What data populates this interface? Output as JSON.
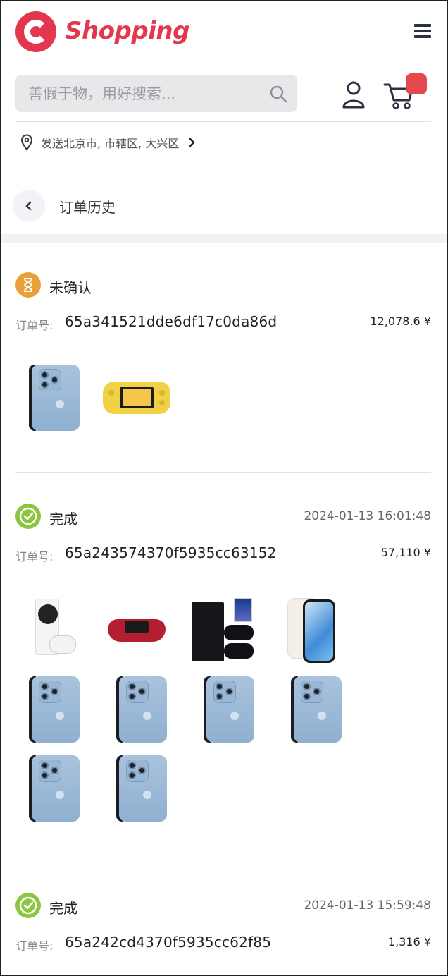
{
  "header": {
    "logo_text": "Shopping",
    "brand_color": "#e2384f",
    "search_placeholder": "善假于物，用好搜索...",
    "location": "发送北京市, 市辖区, 大兴区"
  },
  "page": {
    "title": "订单历史"
  },
  "orders": [
    {
      "status": "未确认",
      "status_icon": "hourglass-icon",
      "status_color": "#e8a13a",
      "date": "",
      "id_label": "订单号:",
      "id": "65a341521dde6df17c0da86d",
      "price": "12,078.6 ¥",
      "items": [
        "iphone-13-pro-sierra-blue",
        "nintendo-switch-lite-yellow"
      ]
    },
    {
      "status": "完成",
      "status_icon": "check-circle-icon",
      "status_color": "#8cc63f",
      "date": "2024-01-13 16:01:48",
      "id_label": "订单号:",
      "id": "65a243574370f5935cc63152",
      "price": "57,110 ¥",
      "items": [
        "xbox-series-s",
        "dualsense-controller-red",
        "ps4-bundle",
        "iphone-13-white",
        "iphone-13-pro-sierra-blue",
        "iphone-13-pro-sierra-blue",
        "iphone-13-pro-sierra-blue",
        "iphone-13-pro-sierra-blue",
        "iphone-13-pro-sierra-blue",
        "iphone-13-pro-sierra-blue"
      ]
    },
    {
      "status": "完成",
      "status_icon": "check-circle-icon",
      "status_color": "#8cc63f",
      "date": "2024-01-13 15:59:48",
      "id_label": "订单号:",
      "id": "65a242cd4370f5935cc62f85",
      "price": "1,316 ¥",
      "items": []
    }
  ]
}
